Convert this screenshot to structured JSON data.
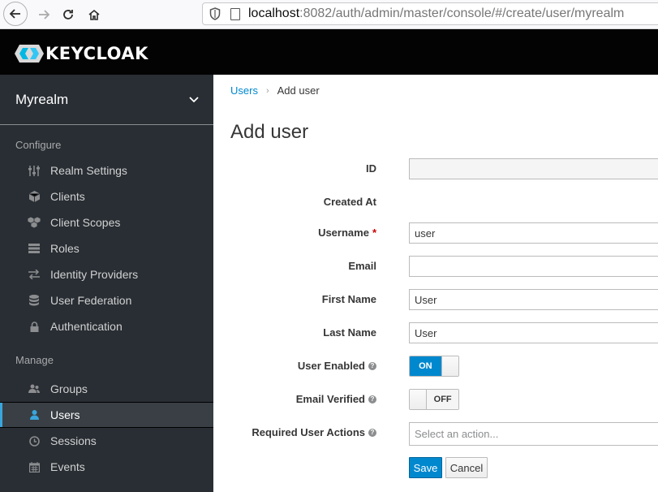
{
  "browser": {
    "url_host": "localhost",
    "url_rest": ":8082/auth/admin/master/console/#/create/user/myrealm"
  },
  "header": {
    "logo_text": "KEYCLOAK"
  },
  "sidebar": {
    "realm": "Myrealm",
    "configure_title": "Configure",
    "configure_items": [
      {
        "label": "Realm Settings",
        "icon": "sliders-icon"
      },
      {
        "label": "Clients",
        "icon": "cube-icon"
      },
      {
        "label": "Client Scopes",
        "icon": "cubes-icon"
      },
      {
        "label": "Roles",
        "icon": "list-icon"
      },
      {
        "label": "Identity Providers",
        "icon": "exchange-icon"
      },
      {
        "label": "User Federation",
        "icon": "database-icon"
      },
      {
        "label": "Authentication",
        "icon": "lock-icon"
      }
    ],
    "manage_title": "Manage",
    "manage_items": [
      {
        "label": "Groups",
        "icon": "users-icon"
      },
      {
        "label": "Users",
        "icon": "user-icon",
        "active": true
      },
      {
        "label": "Sessions",
        "icon": "clock-icon"
      },
      {
        "label": "Events",
        "icon": "calendar-icon"
      }
    ]
  },
  "breadcrumb": {
    "parent": "Users",
    "current": "Add user"
  },
  "page_title": "Add user",
  "form": {
    "id_label": "ID",
    "id_value": "",
    "created_at_label": "Created At",
    "username_label": "Username",
    "username_required": "*",
    "username_value": "user",
    "email_label": "Email",
    "email_value": "",
    "first_name_label": "First Name",
    "first_name_value": "User",
    "last_name_label": "Last Name",
    "last_name_value": "User",
    "user_enabled_label": "User Enabled",
    "user_enabled_state": "ON",
    "email_verified_label": "Email Verified",
    "email_verified_state": "OFF",
    "required_actions_label": "Required User Actions",
    "required_actions_placeholder": "Select an action...",
    "save_label": "Save",
    "cancel_label": "Cancel"
  },
  "colors": {
    "accent": "#0088ce",
    "sidebar_bg": "#292e34",
    "header_bg": "#030303",
    "active_bar": "#39a5dc"
  }
}
